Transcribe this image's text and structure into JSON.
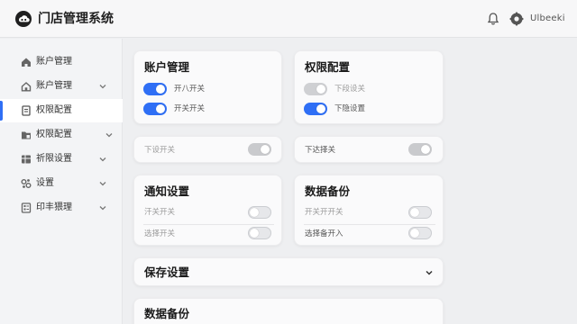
{
  "app": {
    "title": "门店管理系统",
    "user_label": "Ulbeeki"
  },
  "icons": {
    "logo": "cloud-logo-icon",
    "bell": "bell-icon",
    "settings": "gear-icon"
  },
  "colors": {
    "accent": "#2f6ff5",
    "toggle_off": "#e6e7ea"
  },
  "sidebar": {
    "items": [
      {
        "label": "账户管理",
        "icon": "home-icon",
        "has_chevron": false,
        "active": false
      },
      {
        "label": "账户管理",
        "icon": "home-outline-icon",
        "has_chevron": true,
        "active": false
      },
      {
        "label": "权限配置",
        "icon": "document-icon",
        "has_chevron": false,
        "active": true
      },
      {
        "label": "权限配置",
        "icon": "folder-icon",
        "has_chevron": true,
        "active": false
      },
      {
        "label": "祈限设置",
        "icon": "grid-icon",
        "has_chevron": true,
        "active": false
      },
      {
        "label": "设置",
        "icon": "sliders-icon",
        "has_chevron": true,
        "active": false
      },
      {
        "label": "印丰猥理",
        "icon": "list-icon",
        "has_chevron": true,
        "active": false
      }
    ]
  },
  "cards": {
    "account": {
      "title": "账户管理",
      "rows": [
        {
          "label": "开八开关",
          "state": "on"
        },
        {
          "label": "开关开关",
          "state": "on"
        }
      ]
    },
    "permissions": {
      "title": "权限配置",
      "rows": [
        {
          "label": "下段设关",
          "state": "on-muted"
        },
        {
          "label": "下隐设置",
          "state": "on"
        }
      ]
    },
    "single_left": {
      "label": "下设开关",
      "state": "off-gray"
    },
    "single_right": {
      "label": "下达择关",
      "state": "off-gray"
    },
    "notify": {
      "title": "通知设置",
      "rows": [
        {
          "label": "汗关开关",
          "state": "off"
        },
        {
          "label": "选择开关",
          "state": "off"
        }
      ]
    },
    "backup": {
      "title": "数据备份",
      "rows": [
        {
          "label": "开关开开关",
          "state": "off"
        },
        {
          "label": "选择备开入",
          "state": "off"
        }
      ]
    },
    "save": {
      "title": "保存设置"
    },
    "backup2": {
      "title": "数据备份"
    }
  }
}
